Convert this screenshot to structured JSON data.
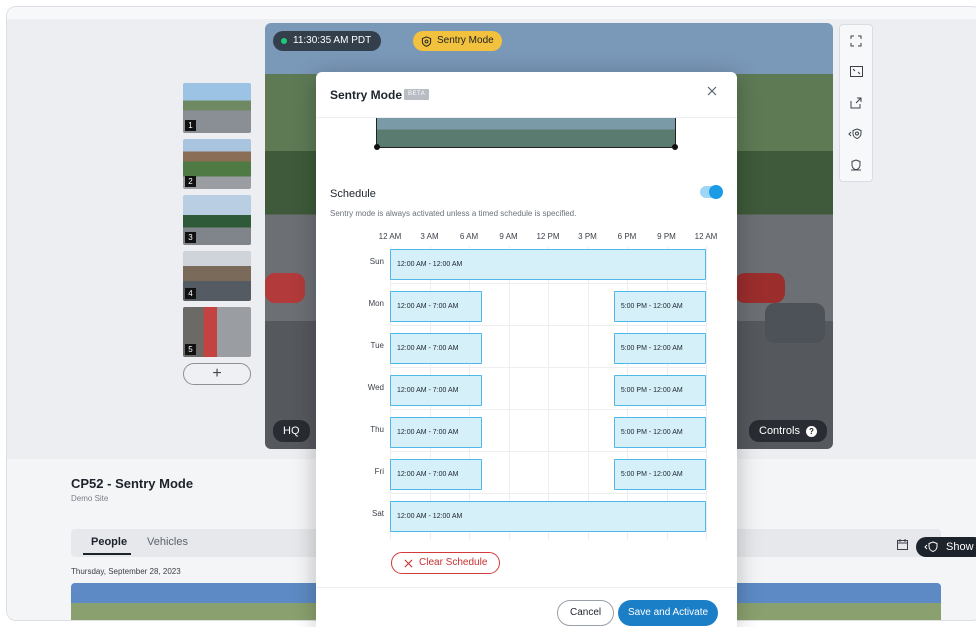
{
  "feed": {
    "timestamp": "11:30:35 AM PDT",
    "sentry_label": "Sentry Mode",
    "quality_label": "HQ",
    "controls_label": "Controls"
  },
  "thumbnails": [
    {
      "num": "1"
    },
    {
      "num": "2"
    },
    {
      "num": "3"
    },
    {
      "num": "4"
    },
    {
      "num": "5"
    }
  ],
  "add_thumb_label": "+",
  "tools": [
    "expand-icon",
    "fit-screen-icon",
    "share-icon",
    "sentry-shield-icon",
    "badge-icon"
  ],
  "camera": {
    "title": "CP52 - Sentry Mode",
    "site": "Demo Site"
  },
  "tabs": [
    {
      "label": "People",
      "active": true
    },
    {
      "label": "Vehicles",
      "active": false
    }
  ],
  "date_line": "Thursday, September 28, 2023",
  "show_button_label": "Show",
  "modal": {
    "title": "Sentry Mode",
    "badge": "BETA",
    "schedule_label": "Schedule",
    "schedule_enabled": true,
    "schedule_description": "Sentry mode is always activated unless a timed schedule is specified.",
    "hours": [
      "12 AM",
      "3 AM",
      "6 AM",
      "9 AM",
      "12 PM",
      "3 PM",
      "6 PM",
      "9 PM",
      "12 AM"
    ],
    "days": [
      {
        "day": "Sun",
        "blocks": [
          {
            "label": "12:00 AM - 12:00 AM",
            "start": 0,
            "end": 24
          }
        ]
      },
      {
        "day": "Mon",
        "blocks": [
          {
            "label": "12:00 AM - 7:00 AM",
            "start": 0,
            "end": 7
          },
          {
            "label": "5:00 PM - 12:00 AM",
            "start": 17,
            "end": 24
          }
        ]
      },
      {
        "day": "Tue",
        "blocks": [
          {
            "label": "12:00 AM - 7:00 AM",
            "start": 0,
            "end": 7
          },
          {
            "label": "5:00 PM - 12:00 AM",
            "start": 17,
            "end": 24
          }
        ]
      },
      {
        "day": "Wed",
        "blocks": [
          {
            "label": "12:00 AM - 7:00 AM",
            "start": 0,
            "end": 7
          },
          {
            "label": "5:00 PM - 12:00 AM",
            "start": 17,
            "end": 24
          }
        ]
      },
      {
        "day": "Thu",
        "blocks": [
          {
            "label": "12:00 AM - 7:00 AM",
            "start": 0,
            "end": 7
          },
          {
            "label": "5:00 PM - 12:00 AM",
            "start": 17,
            "end": 24
          }
        ]
      },
      {
        "day": "Fri",
        "blocks": [
          {
            "label": "12:00 AM - 7:00 AM",
            "start": 0,
            "end": 7
          },
          {
            "label": "5:00 PM - 12:00 AM",
            "start": 17,
            "end": 24
          }
        ]
      },
      {
        "day": "Sat",
        "blocks": [
          {
            "label": "12:00 AM - 12:00 AM",
            "start": 0,
            "end": 24
          }
        ]
      }
    ],
    "clear_label": "Clear Schedule",
    "cancel_label": "Cancel",
    "save_label": "Save and Activate"
  },
  "colors": {
    "accent": "#1b7fc7",
    "block_fill": "#d6f0f9",
    "block_border": "#4fb8e8",
    "danger": "#d23b3b",
    "sentry_yellow": "#f2c23e"
  }
}
